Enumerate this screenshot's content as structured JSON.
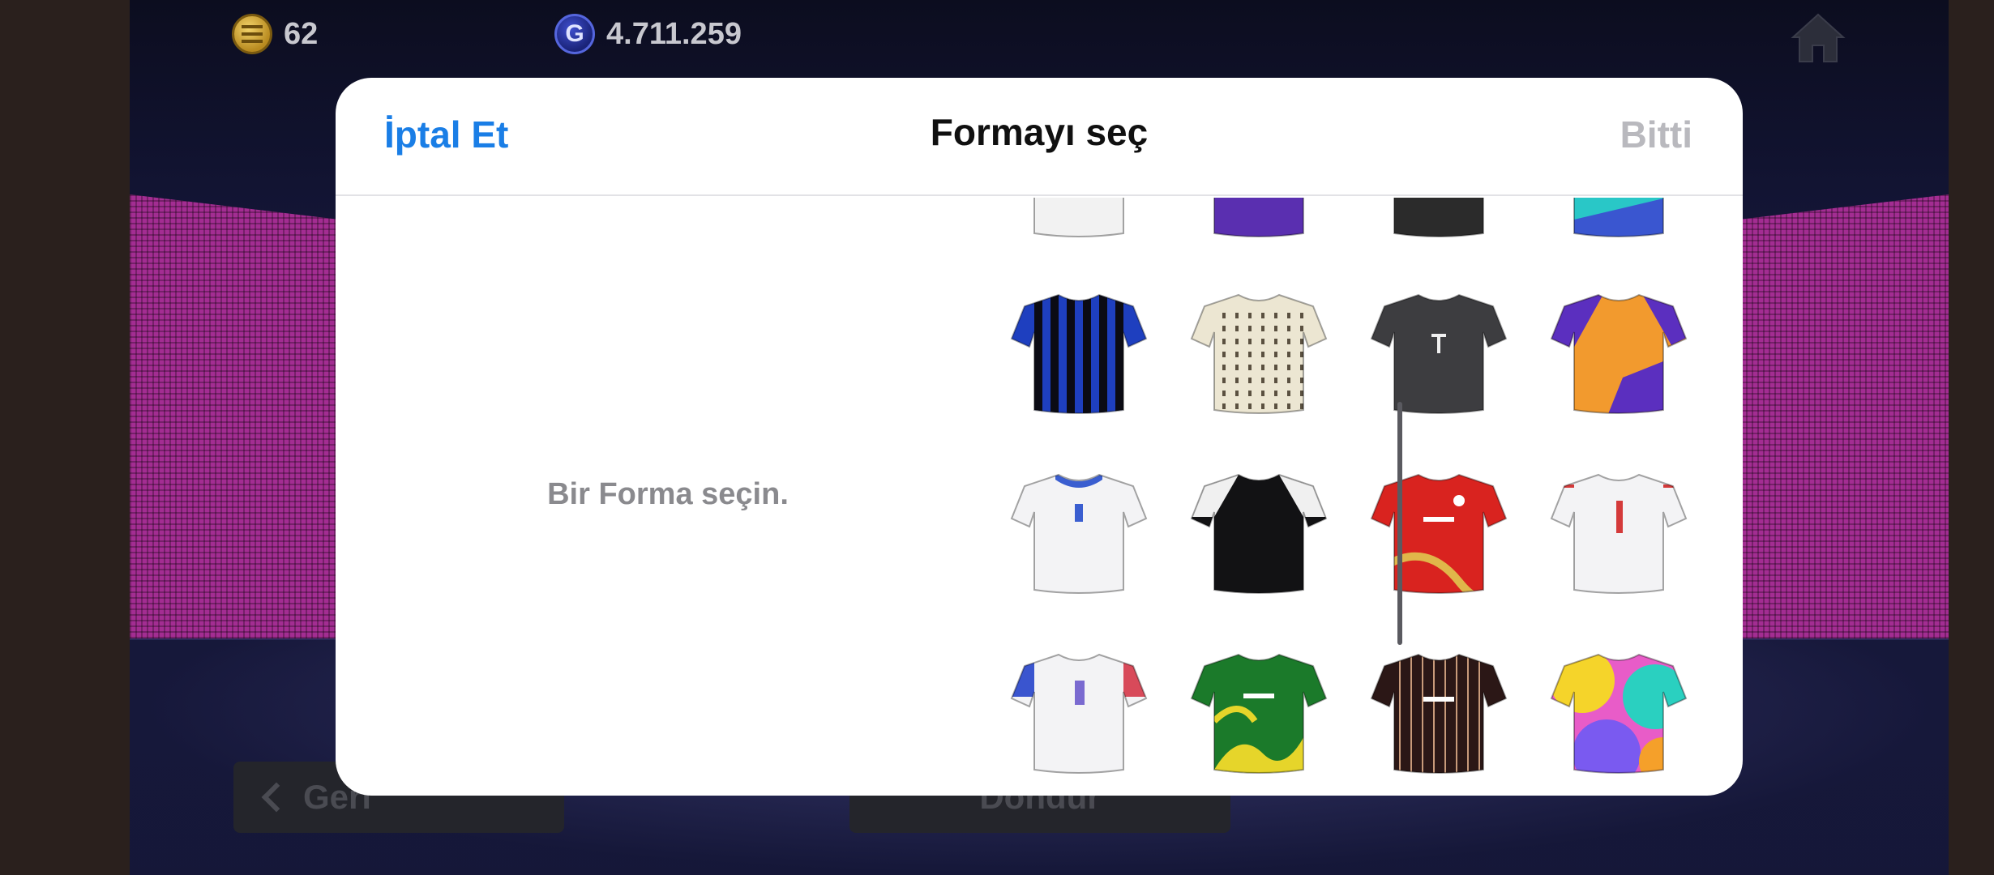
{
  "currency": {
    "coins": "62",
    "gp": "4.711.259",
    "coin_icon": "efootball-coin-icon",
    "gp_icon": "gp-icon",
    "gp_glyph": "G"
  },
  "background_buttons": {
    "back_label": "Geri",
    "rotate_label": "Döndür"
  },
  "dialog": {
    "cancel_label": "İptal Et",
    "title": "Formayı seç",
    "done_label": "Bitti",
    "empty_message": "Bir Forma seçin."
  },
  "colors": {
    "accent_blue": "#1a7ee6",
    "disabled_gray": "#b9b9be",
    "led_magenta": "#a32d92"
  },
  "kits": [
    {
      "id": "kit-r0-1",
      "style": "white-navy-sleeves",
      "main": "#f2f2f2",
      "accent": "#2a2f7a",
      "partial": true
    },
    {
      "id": "kit-r0-2",
      "style": "purple",
      "main": "#5a2fb0",
      "accent": "#3a1e88",
      "partial": true
    },
    {
      "id": "kit-r0-3",
      "style": "black",
      "main": "#2b2b2b",
      "accent": "#151515",
      "partial": true
    },
    {
      "id": "kit-r0-4",
      "style": "teal-blue",
      "main": "#3a56d0",
      "accent": "#29c7c7",
      "partial": true
    },
    {
      "id": "kit-r1-1",
      "style": "blue-black-stripes",
      "main": "#1e3fbf",
      "accent": "#0b0b14"
    },
    {
      "id": "kit-r1-2",
      "style": "cream-pattern",
      "main": "#ece6d2",
      "accent": "#5a5040"
    },
    {
      "id": "kit-r1-3",
      "style": "dark-gray",
      "main": "#3d3d40",
      "accent": "#f0f0f0"
    },
    {
      "id": "kit-r1-4",
      "style": "orange-purple",
      "main": "#f29a2e",
      "accent": "#5b2fbf"
    },
    {
      "id": "kit-r2-1",
      "style": "white-blue-collar",
      "main": "#f3f3f5",
      "accent": "#3a5ed0"
    },
    {
      "id": "kit-r2-2",
      "style": "black-white-shoulders",
      "main": "#121214",
      "accent": "#f0f0f0"
    },
    {
      "id": "kit-r2-3",
      "style": "red-gold",
      "main": "#d9231f",
      "accent": "#e0b64a"
    },
    {
      "id": "kit-r2-4",
      "style": "white-red",
      "main": "#f3f3f5",
      "accent": "#d43a3a"
    },
    {
      "id": "kit-r3-1",
      "style": "white-blue-red-sleeves",
      "main": "#f3f3f5",
      "accent": "#3a55cf"
    },
    {
      "id": "kit-r3-2",
      "style": "green-yellow",
      "main": "#1b7a2a",
      "accent": "#e6d52a"
    },
    {
      "id": "kit-r3-3",
      "style": "dark-brown-pinstripe",
      "main": "#2b1716",
      "accent": "#c89a7a"
    },
    {
      "id": "kit-r3-4",
      "style": "tie-dye",
      "main": "#e85cc8",
      "accent": "#2ad0c0"
    }
  ]
}
